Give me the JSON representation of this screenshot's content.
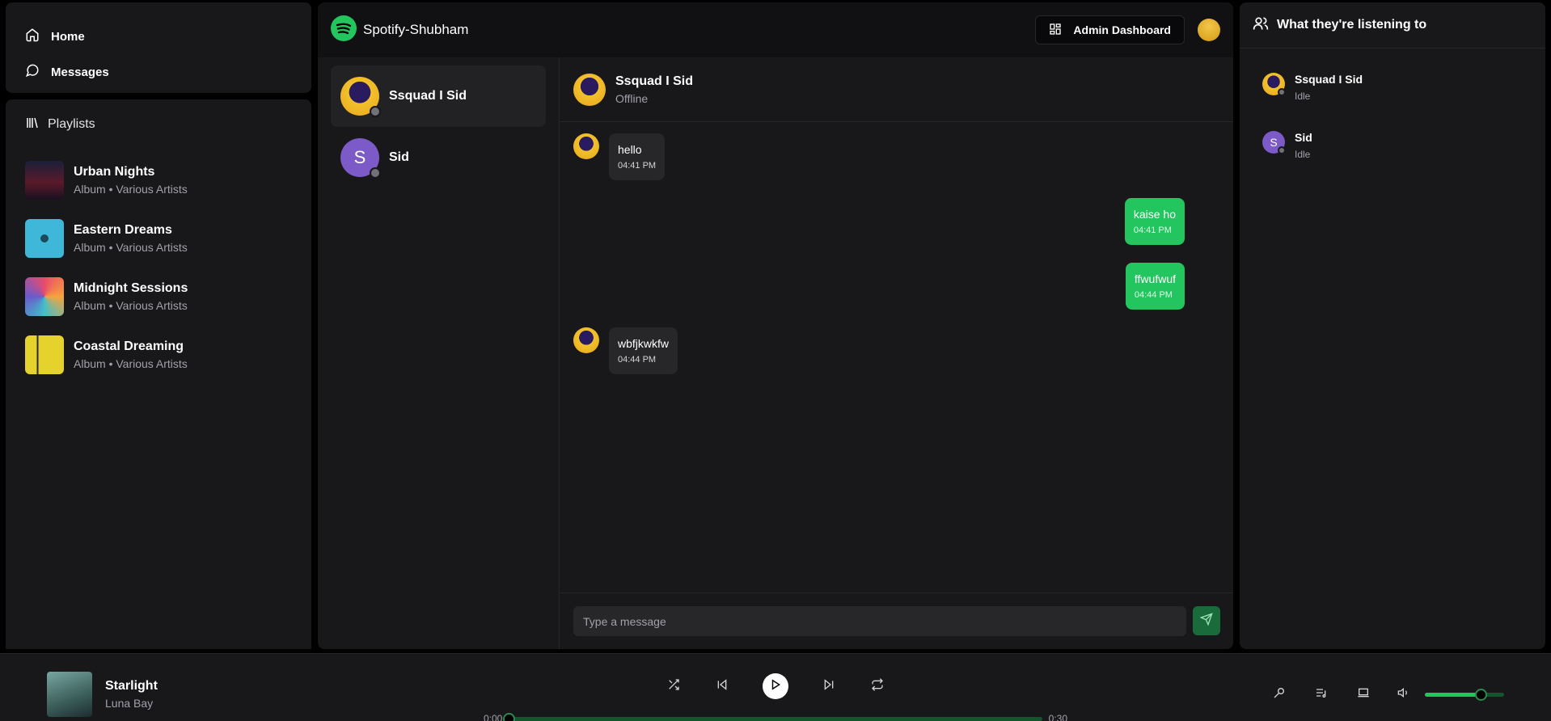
{
  "nav": {
    "home_label": "Home",
    "messages_label": "Messages"
  },
  "playlists": {
    "header": "Playlists",
    "items": [
      {
        "title": "Urban Nights",
        "subtitle": "Album • Various Artists",
        "cover_color": "#3a1f2a"
      },
      {
        "title": "Eastern Dreams",
        "subtitle": "Album • Various Artists",
        "cover_color": "#3fb7d9"
      },
      {
        "title": "Midnight Sessions",
        "subtitle": "Album • Various Artists",
        "cover_color": "#7a4bb0"
      },
      {
        "title": "Coastal Dreaming",
        "subtitle": "Album • Various Artists",
        "cover_color": "#e5d22c"
      }
    ]
  },
  "topbar": {
    "app_name": "Spotify-Shubham",
    "admin_label": "Admin Dashboard"
  },
  "contacts": [
    {
      "name": "Ssquad I Sid",
      "avatar": "image",
      "active": true
    },
    {
      "name": "Sid",
      "avatar_letter": "S",
      "active": false
    }
  ],
  "chat": {
    "header_name": "Ssquad I Sid",
    "header_status": "Offline",
    "messages": [
      {
        "text": "hello",
        "time": "04:41 PM",
        "mine": false
      },
      {
        "text": "kaise ho",
        "time": "04:41 PM",
        "mine": true
      },
      {
        "text": "ffwufwuf",
        "time": "04:44 PM",
        "mine": true
      },
      {
        "text": "wbfjkwkfw",
        "time": "04:44 PM",
        "mine": false
      }
    ],
    "input_placeholder": "Type a message"
  },
  "friends": {
    "header": "What they're listening to",
    "items": [
      {
        "name": "Ssquad I Sid",
        "status": "Idle"
      },
      {
        "name": "Sid",
        "status": "Idle",
        "avatar_letter": "S"
      }
    ]
  },
  "player": {
    "title": "Starlight",
    "artist": "Luna Bay",
    "current_time": "0:00",
    "duration": "0:30",
    "progress": 0,
    "volume": 0.7
  },
  "colors": {
    "accent": "#22c55e",
    "panel": "#18181b",
    "background": "#000000"
  }
}
